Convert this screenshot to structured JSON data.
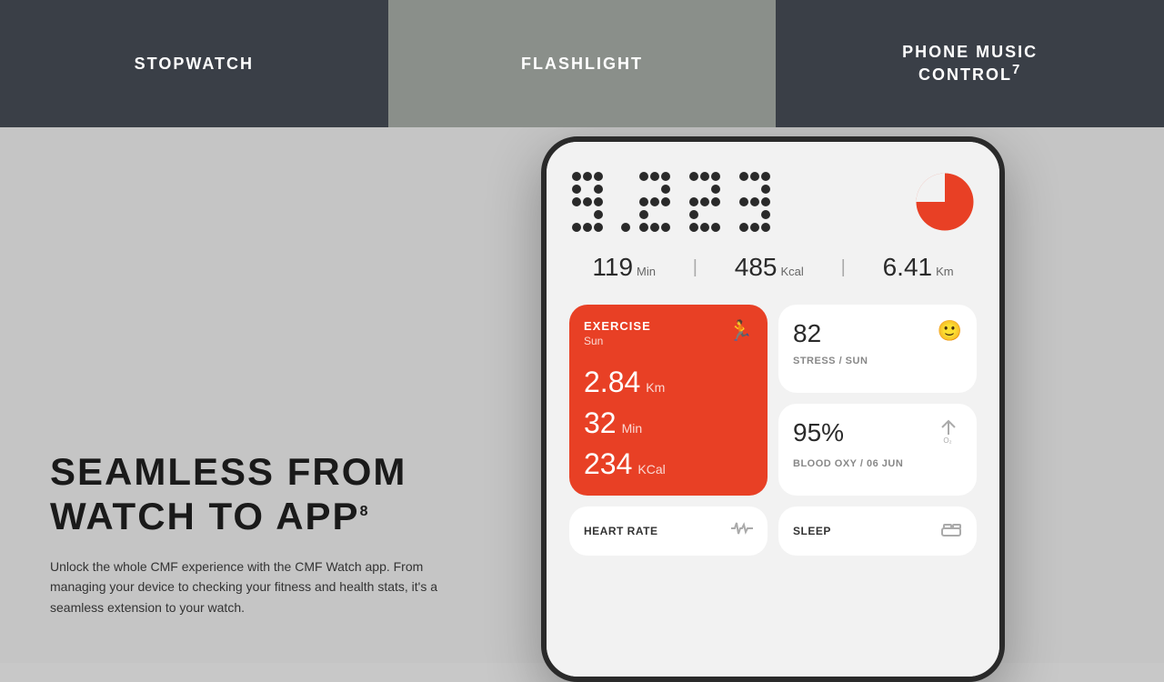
{
  "nav": {
    "items": [
      {
        "label": "STOPWATCH",
        "active": false
      },
      {
        "label": "FLASHLIGHT",
        "active": true
      },
      {
        "label": "PHONE MUSIC CONTROL",
        "superscript": "7",
        "active": false
      }
    ]
  },
  "left": {
    "title_line1": "SEAMLESS FROM",
    "title_line2": "WATCH TO APP",
    "superscript": "8",
    "description": "Unlock the whole CMF experience with the CMF Watch app. From managing your device to checking your fitness and health stats, it's a seamless extension to your watch."
  },
  "phone": {
    "steps": "9,223",
    "stats": [
      {
        "value": "119",
        "unit": "Min"
      },
      {
        "value": "485",
        "unit": "Kcal"
      },
      {
        "value": "6.41",
        "unit": "Km"
      }
    ],
    "exercise": {
      "title": "EXERCISE",
      "day": "Sun",
      "distance": "2.84",
      "distance_unit": "Km",
      "time": "32",
      "time_unit": "Min",
      "calories": "234",
      "calories_unit": "KCal"
    },
    "stress": {
      "value": "82",
      "label": "STRESS / SUN"
    },
    "blood_oxy": {
      "value": "95%",
      "label": "BLOOD OXY / 06 JUN"
    },
    "heart_rate": {
      "label": "HEART RATE"
    },
    "sleep": {
      "label": "SLEEP"
    }
  },
  "colors": {
    "nav_dark": "#3a3f47",
    "nav_mid": "#8a8f8a",
    "exercise_red": "#e84025",
    "background": "#c5c5c5",
    "white": "#ffffff"
  }
}
